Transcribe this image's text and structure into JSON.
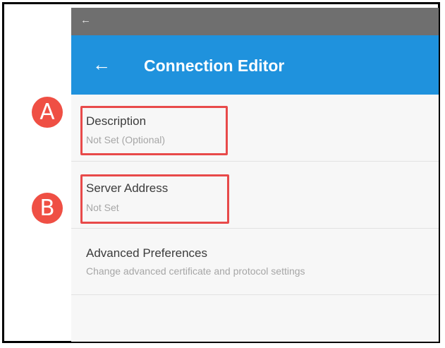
{
  "statusbar": {
    "back_glyph": "←"
  },
  "appbar": {
    "back_glyph": "←",
    "title": "Connection Editor"
  },
  "rows": [
    {
      "label": "Description",
      "sub": "Not Set (Optional)"
    },
    {
      "label": "Server Address",
      "sub": "Not Set"
    },
    {
      "label": "Advanced Preferences",
      "sub": "Change advanced certificate and protocol settings"
    }
  ],
  "annotations": {
    "a": "A",
    "b": "B"
  },
  "colors": {
    "appbar": "#1f92dd",
    "statusbar": "#6f6f6f",
    "highlight": "#e84a4a",
    "badge": "#ef4f44"
  }
}
